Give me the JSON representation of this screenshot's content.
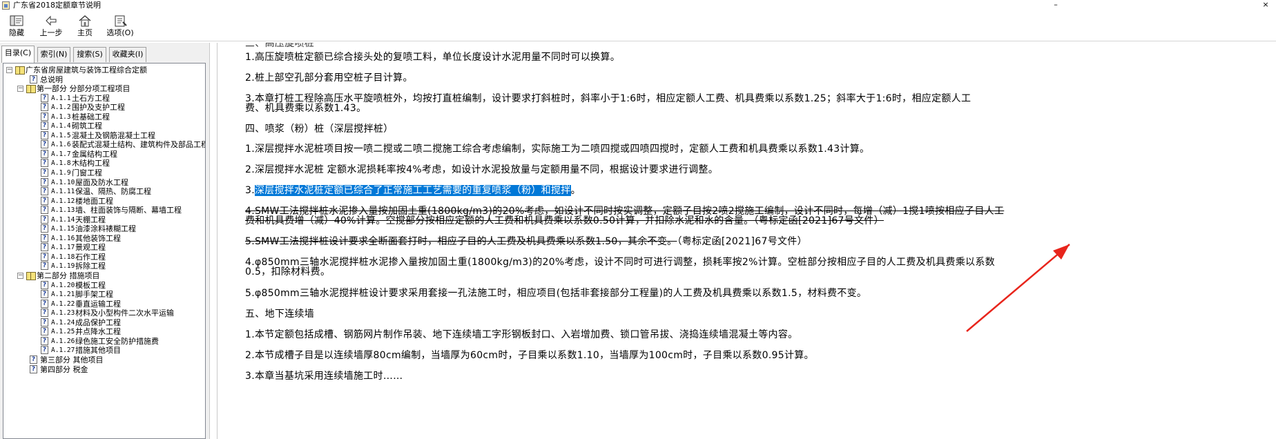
{
  "window": {
    "title": "广东省2018定额章节说明",
    "minimize": "–",
    "close": "×"
  },
  "toolbar": {
    "hide": "隐藏",
    "back": "上一步",
    "home": "主页",
    "options": "选项(O)"
  },
  "tabs": {
    "contents": "目录(C)",
    "index": "索引(N)",
    "search": "搜索(S)",
    "favorites": "收藏夹(I)"
  },
  "tree": [
    {
      "code": "",
      "label": "广东省房屋建筑与装饰工程综合定额"
    },
    {
      "code": "",
      "label": "总说明"
    },
    {
      "code": "",
      "label": "第一部分 分部分项工程项目"
    },
    {
      "code": "A.1.1",
      "label": "土石方工程"
    },
    {
      "code": "A.1.2",
      "label": "围护及支护工程"
    },
    {
      "code": "A.1.3",
      "label": "桩基础工程"
    },
    {
      "code": "A.1.4",
      "label": "砌筑工程"
    },
    {
      "code": "A.1.5",
      "label": "混凝土及钢筋混凝土工程"
    },
    {
      "code": "A.1.6",
      "label": "装配式混凝土结构、建筑构件及部品工程"
    },
    {
      "code": "A.1.7",
      "label": "金属结构工程"
    },
    {
      "code": "A.1.8",
      "label": "木结构工程"
    },
    {
      "code": "A.1.9",
      "label": "门窗工程"
    },
    {
      "code": "A.1.10",
      "label": "屋面及防水工程"
    },
    {
      "code": "A.1.11",
      "label": "保温、隔热、防腐工程"
    },
    {
      "code": "A.1.12",
      "label": "楼地面工程"
    },
    {
      "code": "A.1.13",
      "label": "墙、柱面装饰与隔断、幕墙工程"
    },
    {
      "code": "A.1.14",
      "label": "天棚工程"
    },
    {
      "code": "A.1.15",
      "label": "油漆涂料裱糊工程"
    },
    {
      "code": "A.1.16",
      "label": "其他装饰工程"
    },
    {
      "code": "A.1.17",
      "label": "景观工程"
    },
    {
      "code": "A.1.18",
      "label": "石作工程"
    },
    {
      "code": "A.1.19",
      "label": "拆除工程"
    },
    {
      "code": "",
      "label": "第二部分 措施项目"
    },
    {
      "code": "A.1.20",
      "label": "模板工程"
    },
    {
      "code": "A.1.21",
      "label": "脚手架工程"
    },
    {
      "code": "A.1.22",
      "label": "垂直运输工程"
    },
    {
      "code": "A.1.23",
      "label": "材料及小型构件二次水平运输"
    },
    {
      "code": "A.1.24",
      "label": "成品保护工程"
    },
    {
      "code": "A.1.25",
      "label": "井点降水工程"
    },
    {
      "code": "A.1.26",
      "label": "绿色施工安全防护措施费"
    },
    {
      "code": "A.1.27",
      "label": "措施其他项目"
    },
    {
      "code": "",
      "label": "第三部分 其他项目"
    },
    {
      "code": "",
      "label": "第四部分 税金"
    }
  ],
  "content": {
    "top_partial": "三、高压旋喷桩",
    "p1": "1.高压旋喷桩定额已综合接头处的复喷工料，单位长度设计水泥用量不同时可以换算。",
    "p2": "2.桩上部空孔部分套用空桩子目计算。",
    "p3a": "3.本章打桩工程除高压水平旋喷桩外，均按打直桩编制，设计要求打斜桩时，斜率小于1:6时，相应定额人工费、机具费乘以系数1.25；斜率大于1:6时，相应定额人工",
    "p3b": "费、机具费乘以系数1.43。",
    "h4": "四、喷浆（粉）桩（深层搅拌桩）",
    "q1": "1.深层搅拌水泥桩项目按一喷二搅或二喷二搅施工综合考虑编制，实际施工为二喷四搅或四喷四搅时，定额人工费和机具费乘以系数1.43计算。",
    "q2": "2.深层搅拌水泥桩 定额水泥损耗率按4%考虑，如设计水泥投放量与定额用量不同，根据设计要求进行调整。",
    "q3_prefix": "3.",
    "q3_highlight": "深层搅拌水泥桩定额已综合了正常施工工艺需要的重复喷浆（粉）和搅拌",
    "q3_suffix": "。",
    "s4a": "4.SMW工法搅拌桩水泥掺入量按加固土重(1800kg/m3)的20%考虑，如设计不同时按实调整，定额子目按2喷2搅施工编制，设计不同时，每增（减）1搅1喷按相应子目人工",
    "s4b": "费和机具费增（减）40%计算。空搅部分按相应定额的人工费和机具费乘以系数0.50计算，并扣除水泥和水的含量。（粤标定函[2021]67号文件）",
    "s5_strike": "5.SMW工法搅拌桩设计要求全断面套打时，相应子目的人工费及机具费乘以系数1.50，其余不变。",
    "s5_tail": "（粤标定函[2021]67号文件）",
    "r4a": "4.φ850mm三轴水泥搅拌桩水泥掺入量按加固土重(1800kg/m3)的20%考虑，设计不同时可进行调整，损耗率按2%计算。空桩部分按相应子目的人工费及机具费乘以系数",
    "r4b": "0.5，扣除材料费。",
    "r5": "5.φ850mm三轴水泥搅拌桩设计要求采用套接一孔法施工时，相应项目(包括非套接部分工程量)的人工费及机具费乘以系数1.5，材料费不变。",
    "h5": "五、地下连续墙",
    "w1": "1.本节定额包括成槽、钢筋网片制作吊装、地下连续墙工字形钢板封口、入岩增加费、锁口管吊拔、浇捣连续墙混凝土等内容。",
    "w2": "2.本节成槽子目是以连续墙厚80cm编制，当墙厚为60cm时，子目乘以系数1.10，当墙厚为100cm时，子目乘以系数0.95计算。",
    "w3_partial": "3.本章当基坑采用连续墙施工时……"
  },
  "colors": {
    "selection": "#0078d7",
    "arrow": "#e8251c"
  }
}
